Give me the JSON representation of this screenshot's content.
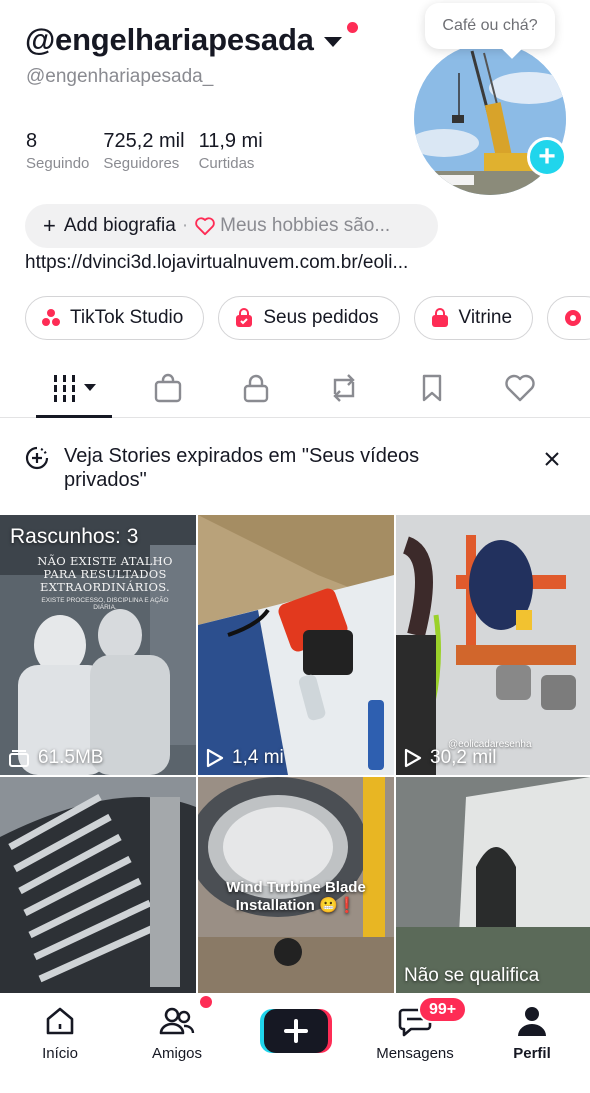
{
  "profile": {
    "display_name": "@engelhariapesada",
    "handle": "@engenhariapesada_",
    "bubble_text": "Café ou chá?",
    "stats": [
      {
        "value": "8",
        "label": "Seguindo"
      },
      {
        "value": "725,2 mil",
        "label": "Seguidores"
      },
      {
        "value": "11,9 mi",
        "label": "Curtidas"
      }
    ],
    "add_bio_label": "Add biografia",
    "bio_separator": "·",
    "hobbies_placeholder": "Meus hobbies são...",
    "link": "https://dvinci3d.lojavirtualnuvem.com.br/eoli..."
  },
  "chips": [
    {
      "label": "TikTok Studio",
      "icon": "tiktok-studio-icon"
    },
    {
      "label": "Seus pedidos",
      "icon": "orders-bag-icon"
    },
    {
      "label": "Vitrine",
      "icon": "storefront-icon"
    }
  ],
  "tabs": [
    "videos-grid-icon",
    "shop-bag-icon",
    "private-lock-icon",
    "repost-icon",
    "bookmark-icon",
    "liked-heart-icon"
  ],
  "banner": {
    "text": "Veja Stories expirados em \"Seus vídeos privados\""
  },
  "videos": [
    {
      "overlay": "Rascunhos: 3",
      "stat": "61.5MB",
      "stat_icon": "drafts-stack-icon",
      "caption": "NÃO EXISTE ATALHO PARA RESULTADOS EXTRAORDINÁRIOS.",
      "caption2": "EXISTE PROCESSO, DISCIPLINA E AÇÃO DIÁRIA."
    },
    {
      "stat": "1,4 mi",
      "stat_icon": "play-icon"
    },
    {
      "stat": "30,2 mil",
      "stat_icon": "play-icon",
      "watermark": "@eolicadaresenha"
    },
    {
      "caption": ""
    },
    {
      "caption": "Wind Turbine Blade Installation 😬❗"
    },
    {
      "caption": "Não se qualifica"
    }
  ],
  "bottom_nav": {
    "home": "Início",
    "friends": "Amigos",
    "messages": "Mensagens",
    "messages_badge": "99+",
    "profile": "Perfil"
  },
  "colors": {
    "accent": "#fe2c55",
    "cyan": "#20d5ec",
    "text": "#161823",
    "muted": "#8a8b91"
  }
}
